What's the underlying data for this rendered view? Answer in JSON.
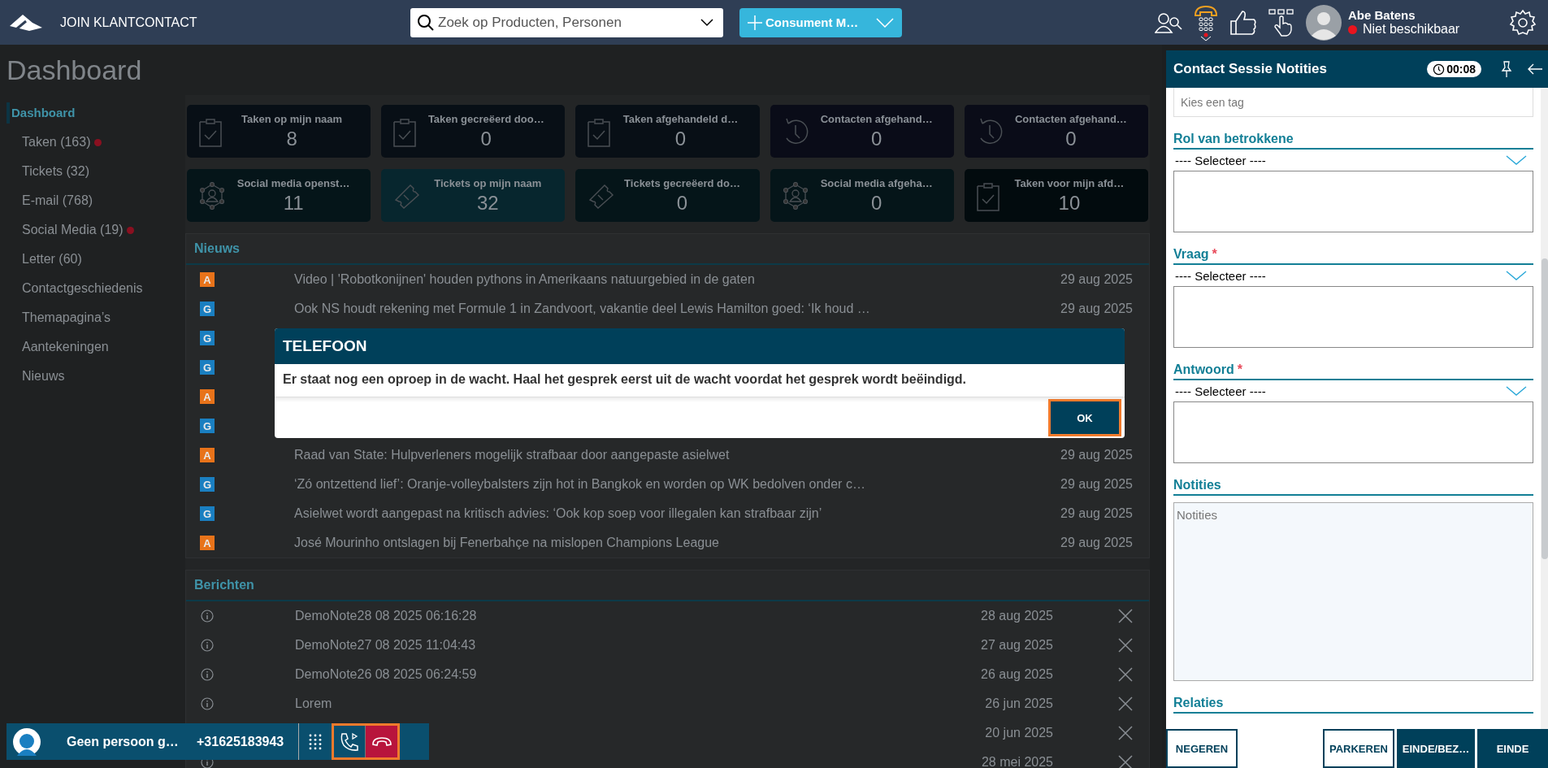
{
  "topbar": {
    "app_name": "JOIN KLANTCONTACT",
    "search": {
      "placeholder": "Zoek op Producten, Personen"
    },
    "new_button": "Consument M…",
    "user": {
      "name": "Abe Batens",
      "status": "Niet beschikbaar",
      "available": false
    }
  },
  "page_title": "Dashboard",
  "sidebar": {
    "items": [
      {
        "label": "Dashboard",
        "selected": true,
        "alert": false
      },
      {
        "label": "Taken (163)",
        "selected": false,
        "alert": true
      },
      {
        "label": "Tickets (32)",
        "selected": false,
        "alert": false
      },
      {
        "label": "E-mail (768)",
        "selected": false,
        "alert": false
      },
      {
        "label": "Social Media (19)",
        "selected": false,
        "alert": true
      },
      {
        "label": "Letter (60)",
        "selected": false,
        "alert": false
      },
      {
        "label": "Contactgeschiedenis",
        "selected": false,
        "alert": false
      },
      {
        "label": "Themapagina’s",
        "selected": false,
        "alert": false
      },
      {
        "label": "Aantekeningen",
        "selected": false,
        "alert": false
      },
      {
        "label": "Nieuws",
        "selected": false,
        "alert": false
      }
    ]
  },
  "tiles": [
    {
      "title": "Taken op mijn naam",
      "value": "8",
      "kind": "task",
      "color": "#080f16"
    },
    {
      "title": "Taken gecreëerd doo…",
      "value": "0",
      "kind": "task",
      "color": "#080f16"
    },
    {
      "title": "Taken afgehandeld d…",
      "value": "0",
      "kind": "task",
      "color": "#080f16"
    },
    {
      "title": "Contacten afgehand…",
      "value": "0",
      "kind": "contact",
      "color": "#0a0c18"
    },
    {
      "title": "Contacten afgehand…",
      "value": "0",
      "kind": "contact",
      "color": "#0a0c18"
    },
    {
      "title": "Social media openst…",
      "value": "11",
      "kind": "social",
      "color": "#051519"
    },
    {
      "title": "Tickets op mijn naam",
      "value": "32",
      "kind": "ticket",
      "color": "#07262e"
    },
    {
      "title": "Tickets gecreëerd do…",
      "value": "0",
      "kind": "ticket",
      "color": "#051519"
    },
    {
      "title": "Social media afgeha…",
      "value": "0",
      "kind": "social",
      "color": "#051519"
    },
    {
      "title": "Taken voor mijn afd…",
      "value": "10",
      "kind": "task",
      "color": "#020b0e"
    }
  ],
  "news": {
    "title": "Nieuws",
    "rows": [
      {
        "source": "A",
        "color": "#e8731a",
        "headline": "Video | 'Robotkonijnen' houden pythons in Amerikaans natuurgebied in de gaten",
        "date": "29 aug 2025"
      },
      {
        "source": "G",
        "color": "#1a7fc1",
        "headline": "Ook NS houdt rekening met Formule 1 in Zandvoort, vakantie deel Lewis Hamilton goed: ‘Ik houd …",
        "date": "29 aug 2025"
      },
      {
        "source": "G",
        "color": "#1a7fc1"
      },
      {
        "source": "G",
        "color": "#1a7fc1"
      },
      {
        "source": "A",
        "color": "#e8731a"
      },
      {
        "source": "G",
        "color": "#1a7fc1"
      },
      {
        "source": "A",
        "color": "#e8731a",
        "headline": "Raad van State: Hulpverleners mogelijk strafbaar door aangepaste asielwet",
        "date": "29 aug 2025"
      },
      {
        "source": "G",
        "color": "#1a7fc1",
        "headline": "‘Zó ontzettend lief’: Oranje-volleybalsters zijn hot in Bangkok en worden op WK bedolven onder c…",
        "date": "29 aug 2025"
      },
      {
        "source": "G",
        "color": "#1a7fc1",
        "headline": "Asielwet wordt aangepast na kritisch advies: ‘Ook kop soep voor illegalen kan strafbaar zijn’",
        "date": "29 aug 2025"
      },
      {
        "source": "A",
        "color": "#e8731a",
        "headline": "José Mourinho ontslagen bij Fenerbahçe na mislopen Champions League",
        "date": "29 aug 2025"
      }
    ]
  },
  "messages": {
    "title": "Berichten",
    "rows": [
      {
        "info": true,
        "title": "DemoNote28 08 2025 06:16:28",
        "date": "28 aug 2025"
      },
      {
        "info": true,
        "title": "DemoNote27 08 2025 11:04:43",
        "date": "27 aug 2025"
      },
      {
        "info": true,
        "title": "DemoNote26 08 2025 06:24:59",
        "date": "26 aug 2025"
      },
      {
        "info": true,
        "title": "Lorem",
        "date": "26 jun 2025"
      },
      {
        "info": false,
        "date": "20 jun 2025"
      },
      {
        "info": true,
        "date": "28 mei 2025"
      }
    ]
  },
  "dialog": {
    "title": "TELEFOON",
    "message": "Er staat nog een oproep in de wacht. Haal het gesprek eerst uit de wacht voordat het gesprek wordt beëindigd.",
    "button": "OK",
    "focused": true
  },
  "call_bar": {
    "caller": "Geen persoon g…",
    "number": "+31625183943",
    "highlighted": true
  },
  "panel": {
    "title": "Contact Sessie Notities",
    "timer": "00:08",
    "tag_field": {
      "placeholder": "Kies een tag"
    },
    "sections": [
      {
        "kind": "select",
        "label": "Rol van betrokkene",
        "value": "---- Selecteer ----"
      },
      {
        "kind": "select",
        "label": "Vraag",
        "required_mark": "*",
        "value": "---- Selecteer ----"
      },
      {
        "kind": "select",
        "label": "Antwoord",
        "required_mark": "*",
        "value": "---- Selecteer ----"
      },
      {
        "kind": "notes",
        "label": "Notities",
        "placeholder": "Notities"
      },
      {
        "kind": "empty",
        "label": "Relaties"
      }
    ],
    "buttons": [
      {
        "label": "NEGEREN",
        "kind": "outline"
      },
      {
        "kind": "spacer"
      },
      {
        "label": "PARKEREN",
        "kind": "outline"
      },
      {
        "label": "EINDE/BEZ…",
        "kind": "filled"
      },
      {
        "label": "EINDE",
        "kind": "filled"
      }
    ]
  }
}
